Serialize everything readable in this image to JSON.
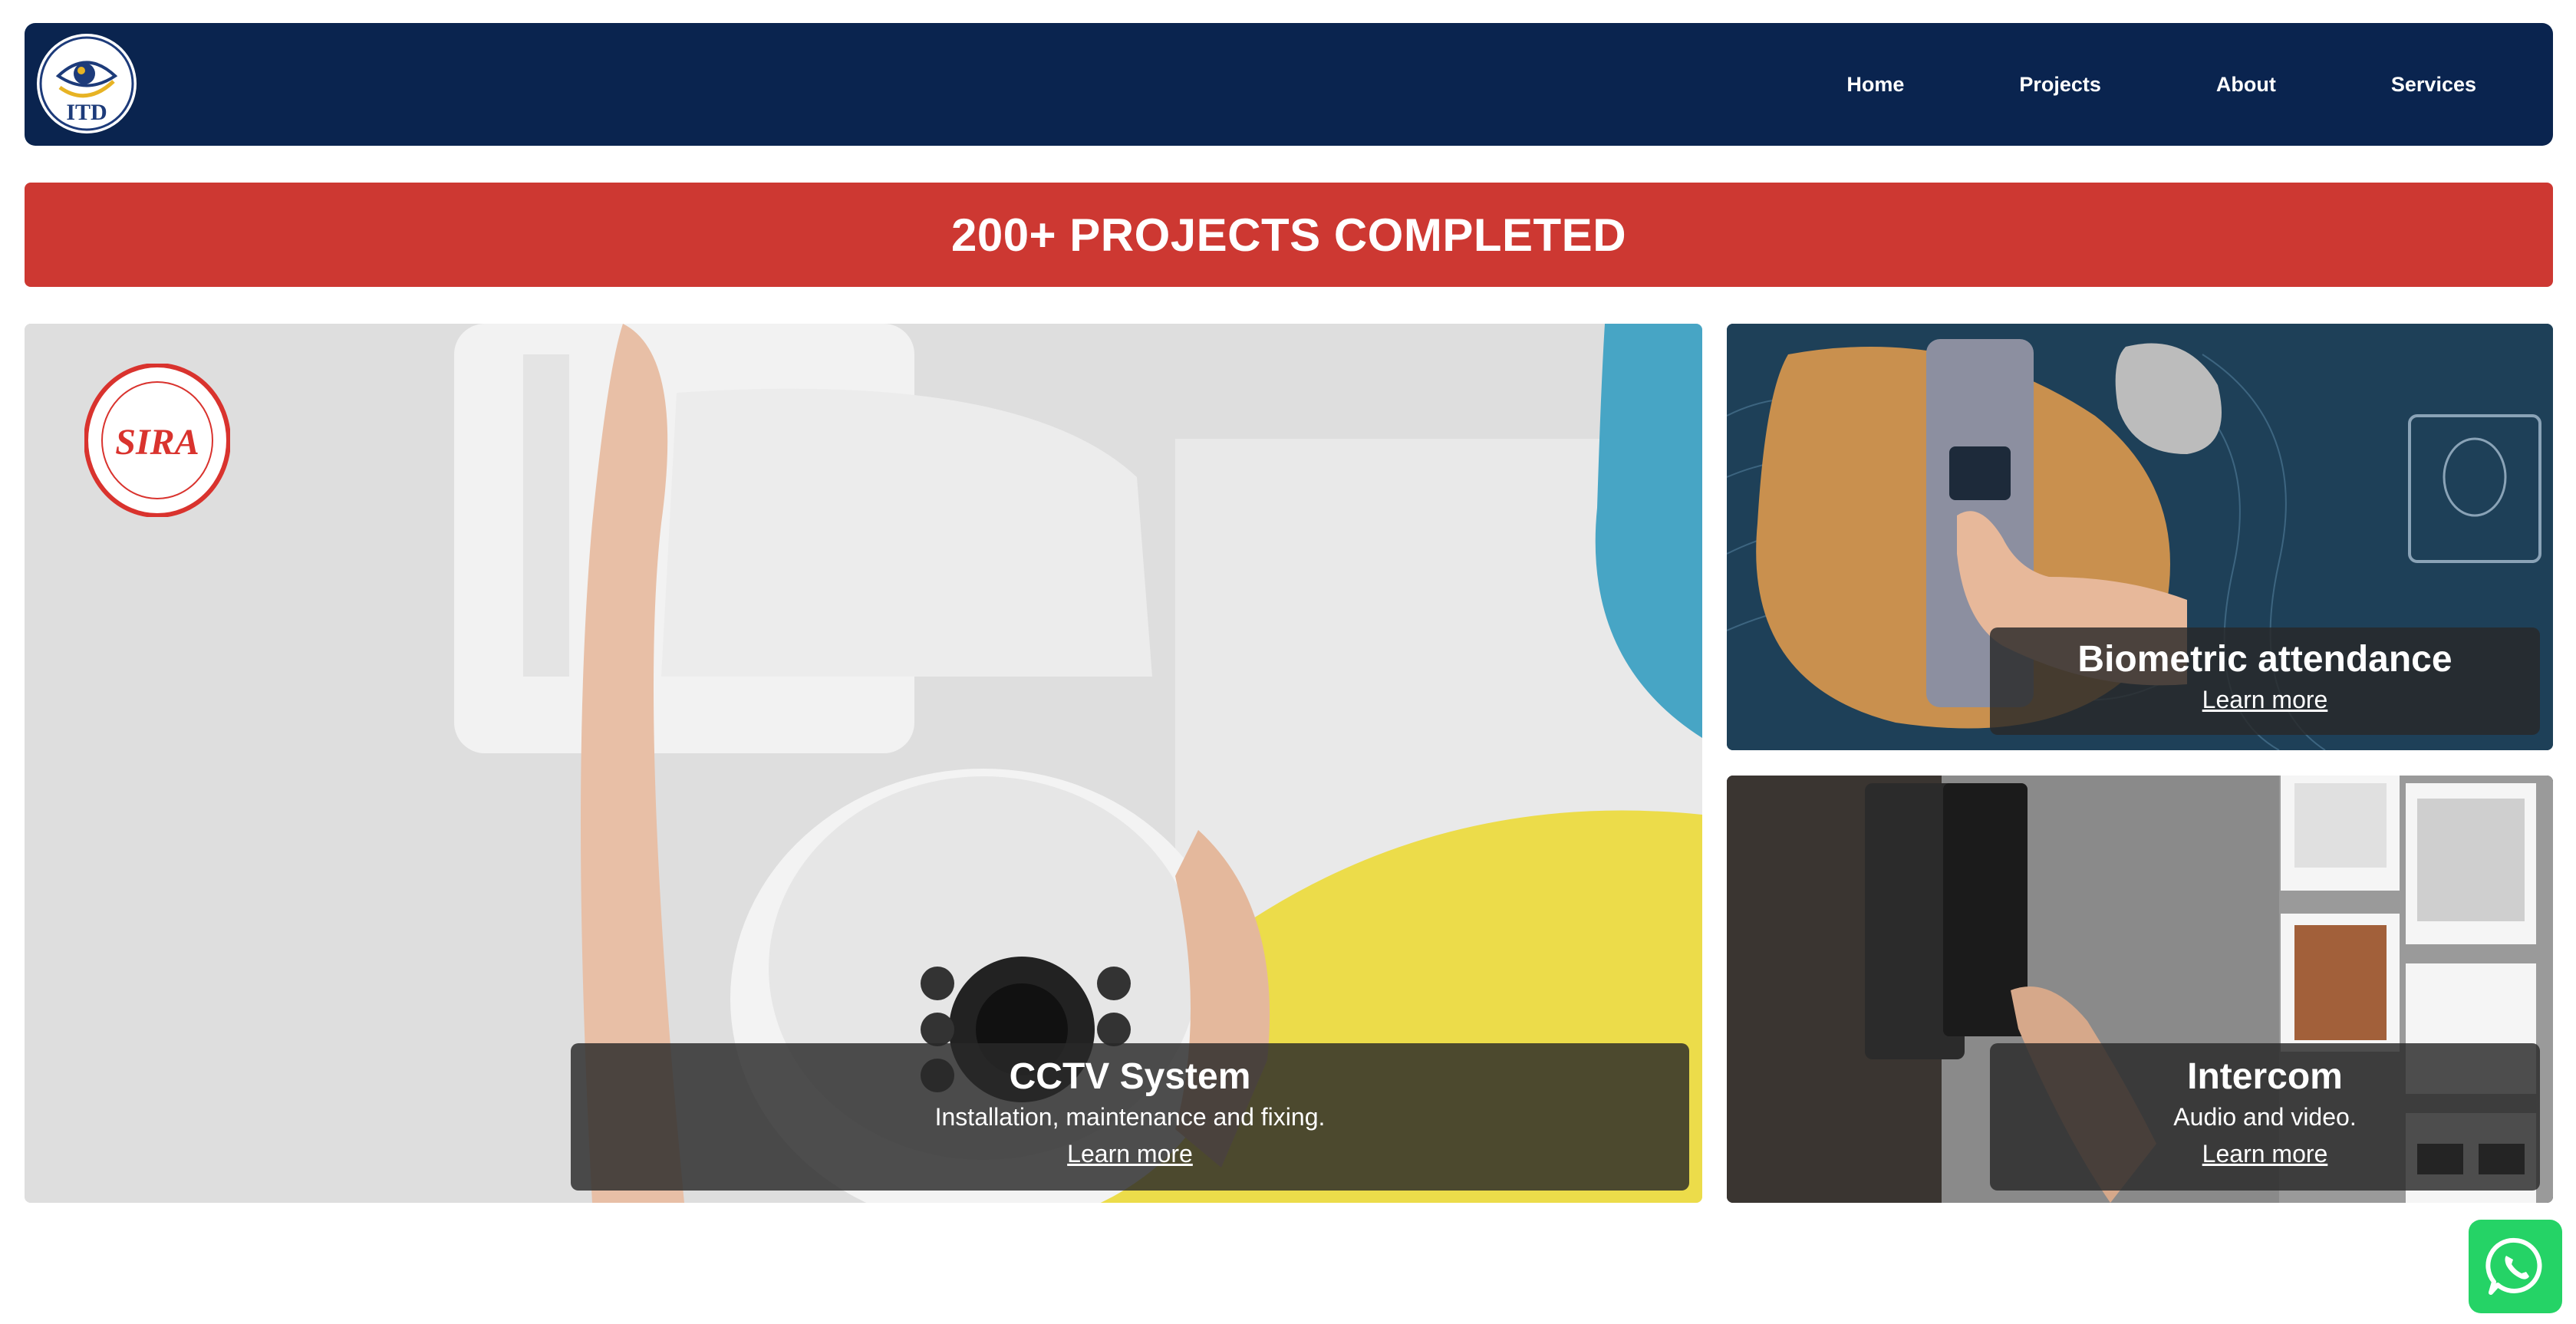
{
  "nav": {
    "logo_text": "ITD",
    "links": [
      {
        "label": "Home"
      },
      {
        "label": "Projects"
      },
      {
        "label": "About"
      },
      {
        "label": "Services"
      }
    ]
  },
  "banner": {
    "text": "200+ PROJECTS COMPLETED"
  },
  "cards": {
    "cctv": {
      "title": "CCTV System",
      "description": "Installation, maintenance and fixing.",
      "link": "Learn more",
      "badge_text": "SIRA"
    },
    "biometric": {
      "title": "Biometric attendance",
      "link": "Learn more"
    },
    "intercom": {
      "title": "Intercom",
      "description": "Audio and video.",
      "link": "Learn more"
    }
  },
  "colors": {
    "navbar": "#0a244f",
    "banner": "#cd3832",
    "overlay": "#282828",
    "whatsapp": "#25d366"
  },
  "icons": {
    "whatsapp": "whatsapp-icon",
    "logo": "itd-eye-logo"
  }
}
